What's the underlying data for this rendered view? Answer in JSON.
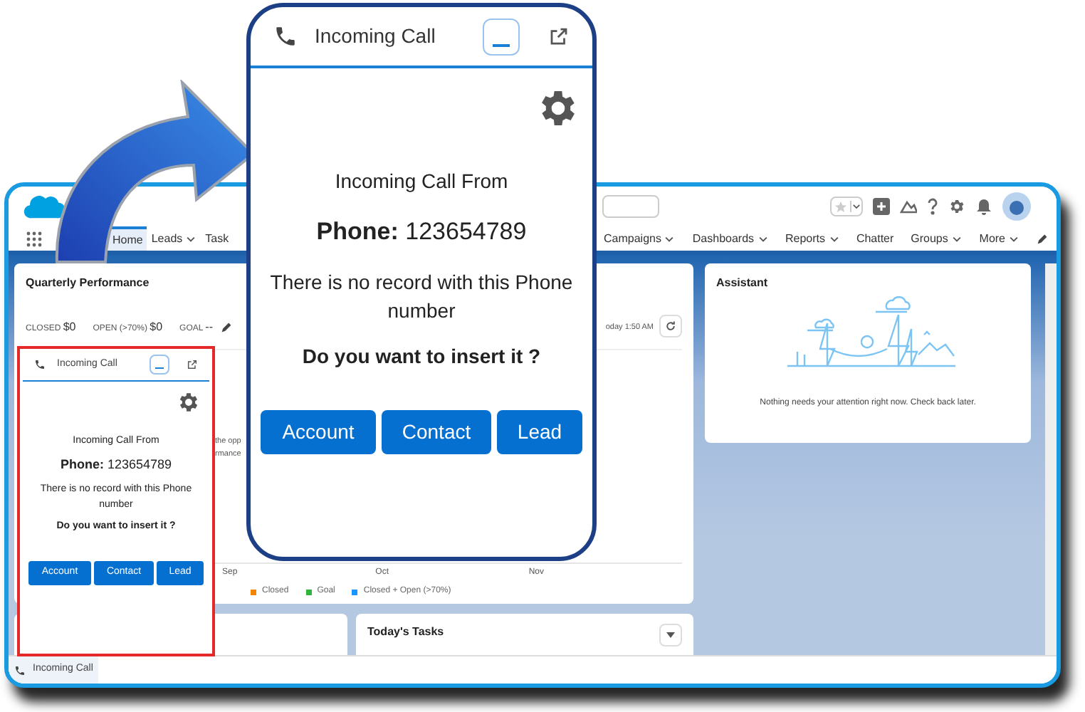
{
  "nav_items": [
    {
      "label": "Home",
      "selected": true,
      "dropdown": false
    },
    {
      "label": "Leads",
      "selected": false,
      "dropdown": true
    },
    {
      "label": "Task",
      "selected": false,
      "dropdown": false
    }
  ],
  "nav_items_right": [
    {
      "label": "Campaigns",
      "dropdown": true
    },
    {
      "label": "Dashboards",
      "dropdown": true
    },
    {
      "label": "Reports",
      "dropdown": true
    },
    {
      "label": "Chatter",
      "dropdown": false
    },
    {
      "label": "Groups",
      "dropdown": true
    },
    {
      "label": "More",
      "dropdown": true
    }
  ],
  "performance_card": {
    "title": "Quarterly Performance",
    "stats": [
      {
        "label": "CLOSED",
        "value": "$0"
      },
      {
        "label": "OPEN (>70%)",
        "value": "$0"
      },
      {
        "label": "GOAL",
        "value": "--"
      }
    ],
    "updated": "oday 1:50 AM",
    "message_fragments": [
      "the opp",
      "rmance"
    ],
    "axis_labels": [
      "Sep",
      "Oct",
      "Nov"
    ],
    "legend": [
      {
        "label": "Closed",
        "color": "#f38303"
      },
      {
        "label": "Goal",
        "color": "#2fb33b"
      },
      {
        "label": "Closed + Open (>70%)",
        "color": "#1b96ff"
      }
    ]
  },
  "assistant": {
    "title": "Assistant",
    "message": "Nothing needs your attention right now. Check back later."
  },
  "tasks_card": {
    "title": "Today's Tasks"
  },
  "utility_bar": {
    "tab": "Incoming Call"
  },
  "docked_call_panel": {
    "title": "Incoming Call",
    "heading": "Incoming Call From",
    "phone_label": "Phone:",
    "phone_number": "123654789",
    "notice": "There is no record with this Phone number",
    "question": "Do you want to insert it ?",
    "buttons": [
      "Account",
      "Contact",
      "Lead"
    ]
  },
  "zoomed_call_panel": {
    "title": "Incoming Call",
    "heading": "Incoming Call From",
    "phone_label": "Phone:",
    "phone_number": "123654789",
    "notice": "There is no record with this Phone number",
    "question": "Do you want to insert it ?",
    "buttons": [
      "Account",
      "Contact",
      "Lead"
    ]
  }
}
